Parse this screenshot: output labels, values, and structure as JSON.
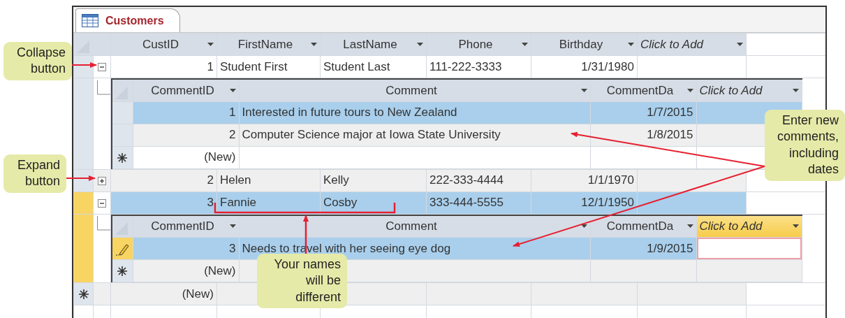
{
  "window": {
    "title": "Customers"
  },
  "columns": [
    {
      "label": "CustID",
      "kind": "number"
    },
    {
      "label": "FirstName",
      "kind": "text"
    },
    {
      "label": "LastName",
      "kind": "text"
    },
    {
      "label": "Phone",
      "kind": "text"
    },
    {
      "label": "Birthday",
      "kind": "date"
    },
    {
      "label": "Click to Add",
      "kind": "add"
    }
  ],
  "customers": [
    {
      "cells": [
        "1",
        "Student First",
        "Student Last",
        "111-222-3333",
        "1/31/1980"
      ],
      "expanded": true,
      "selected": false,
      "current": false,
      "comments": {
        "columns": [
          {
            "label": "CommentID",
            "kind": "number",
            "selected": false
          },
          {
            "label": "Comment",
            "kind": "text",
            "selected": false
          },
          {
            "label": "CommentDa",
            "kind": "date",
            "selected": false
          },
          {
            "label": "Click to Add",
            "kind": "add",
            "selected": false
          }
        ],
        "rows": [
          {
            "cells": [
              "1",
              "Interested in future tours to New Zealand",
              "1/7/2015"
            ],
            "selected": true,
            "editing": false
          },
          {
            "cells": [
              "2",
              "Computer Science major at Iowa State University",
              "1/8/2015"
            ],
            "selected": false,
            "editing": false
          }
        ],
        "new_row": "(New)"
      }
    },
    {
      "cells": [
        "2",
        "Helen",
        "Kelly",
        "222-333-4444",
        "1/1/1970"
      ],
      "expanded": false,
      "selected": false,
      "current": false
    },
    {
      "cells": [
        "3",
        "Fannie",
        "Cosby",
        "333-444-5555",
        "12/1/1950"
      ],
      "expanded": true,
      "selected": true,
      "current": true,
      "comments": {
        "columns": [
          {
            "label": "CommentID",
            "kind": "number",
            "selected": false
          },
          {
            "label": "Comment",
            "kind": "text",
            "selected": false
          },
          {
            "label": "CommentDa",
            "kind": "date",
            "selected": false
          },
          {
            "label": "Click to Add",
            "kind": "add",
            "selected": true
          }
        ],
        "rows": [
          {
            "cells": [
              "3",
              "Needs to travel with her seeing eye dog",
              "1/9/2015"
            ],
            "selected": true,
            "editing": true
          }
        ],
        "new_row": "(New)"
      }
    }
  ],
  "new_row": "(New)",
  "callouts": [
    {
      "kind": "collapse",
      "text": "Collapse\nbutton"
    },
    {
      "kind": "expand",
      "text": "Expand\nbutton"
    },
    {
      "kind": "comments",
      "text": "Enter new\ncomments,\nincluding\ndates"
    },
    {
      "kind": "names",
      "text": "Your names\nwill be\ndifferent"
    }
  ]
}
